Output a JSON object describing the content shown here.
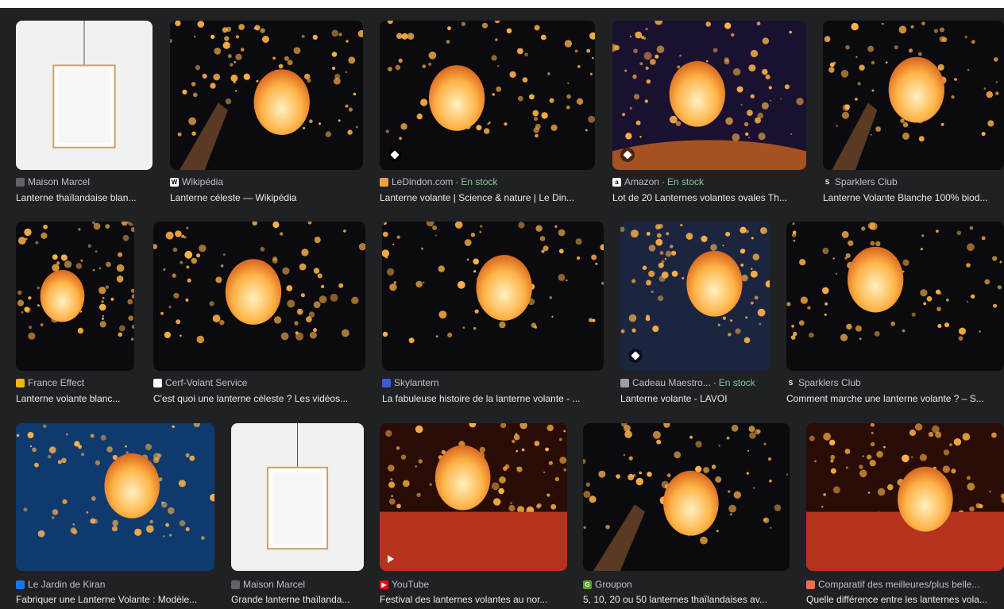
{
  "rows": [
    [
      {
        "source": "Maison Marcel",
        "stock": "",
        "title": "Lanterne thaïlandaise blan...",
        "favicon": "maison-marcel-icon",
        "thumb": "white-lamp",
        "badge": ""
      },
      {
        "source": "Wikipédia",
        "stock": "",
        "title": "Lanterne céleste — Wikipédia",
        "favicon": "wikipedia-icon",
        "thumb": "hands-lantern",
        "badge": ""
      },
      {
        "source": "LeDindon.com",
        "stock": "En stock",
        "title": "Lanterne volante | Science & nature | Le Din...",
        "favicon": "ledindon-icon",
        "thumb": "many-lanterns",
        "badge": "tag"
      },
      {
        "source": "Amazon",
        "stock": "En stock",
        "title": "Lot de 20 Lanternes volantes ovales Th...",
        "favicon": "amazon-icon",
        "thumb": "sunset-lanterns",
        "badge": "tag"
      },
      {
        "source": "Sparklers Club",
        "stock": "",
        "title": "Lanterne Volante Blanche 100% biod...",
        "favicon": "sparklers-icon",
        "thumb": "hands-lantern-2",
        "badge": ""
      }
    ],
    [
      {
        "source": "France Effect",
        "stock": "",
        "title": "Lanterne volante blanc...",
        "favicon": "france-effect-icon",
        "thumb": "single-lantern",
        "badge": ""
      },
      {
        "source": "Cerf-Volant Service",
        "stock": "",
        "title": "C'est quoi une lanterne céleste ? Les vidéos...",
        "favicon": "cerf-volant-icon",
        "thumb": "dark-lantern",
        "badge": ""
      },
      {
        "source": "Skylantern",
        "stock": "",
        "title": "La fabuleuse histoire de la lanterne volante - ...",
        "favicon": "skylantern-icon",
        "thumb": "crowd-lanterns",
        "badge": ""
      },
      {
        "source": "Cadeau Maestro...",
        "stock": "En stock",
        "title": "Lanterne volante - LAVOI",
        "favicon": "cadeau-maestro-icon",
        "thumb": "sky-dots",
        "badge": "tag"
      },
      {
        "source": "Sparklers Club",
        "stock": "",
        "title": "Comment marche une lanterne volante ? – S...",
        "favicon": "sparklers-icon",
        "thumb": "many-lanterns-2",
        "badge": ""
      }
    ],
    [
      {
        "source": "Le Jardin de Kiran",
        "stock": "",
        "title": "Fabriquer une Lanterne Volante : Modèle...",
        "favicon": "jardin-kiran-icon",
        "thumb": "blue-sky-lantern",
        "badge": ""
      },
      {
        "source": "Maison Marcel",
        "stock": "",
        "title": "Grande lanterne thaïlanda...",
        "favicon": "maison-marcel-icon",
        "thumb": "white-lamp-2",
        "badge": ""
      },
      {
        "source": "YouTube",
        "stock": "",
        "title": "Festival des lanternes volantes au nor...",
        "favicon": "youtube-icon",
        "thumb": "red-festival",
        "badge": "play"
      },
      {
        "source": "Groupon",
        "stock": "",
        "title": "5, 10, 20 ou 50 lanternes thaïlandaises av...",
        "favicon": "groupon-icon",
        "thumb": "hands-lantern-3",
        "badge": ""
      },
      {
        "source": "Comparatif des meilleures/plus belle...",
        "stock": "",
        "title": "Quelle différence entre les lanternes vola...",
        "favicon": "comparatif-icon",
        "thumb": "red-festival-2",
        "badge": ""
      }
    ]
  ],
  "colors": {
    "background": "#202124",
    "stock_green": "#81c995",
    "source_text": "#bdc1c6",
    "title_text": "#e8eaed"
  }
}
